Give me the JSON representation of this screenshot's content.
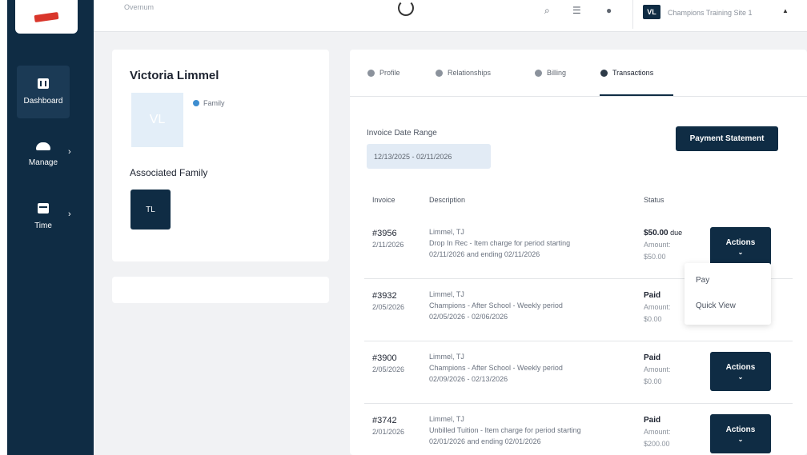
{
  "topbar": {
    "search_text": "Overnum",
    "site_avatar": "VL",
    "site_name": "Champions Training Site 1"
  },
  "sidebar": {
    "items": [
      {
        "label": "Dashboard",
        "icon": "dashboard-icon",
        "active": true
      },
      {
        "label": "Manage",
        "icon": "people-icon"
      },
      {
        "label": "Time",
        "icon": "calendar-icon"
      }
    ]
  },
  "profile": {
    "name": "Victoria Limmel",
    "avatar": "VL",
    "role": "Family",
    "assoc_label": "Associated Family",
    "assoc_avatar": "TL"
  },
  "tabs": [
    {
      "label": "Profile"
    },
    {
      "label": "Relationships"
    },
    {
      "label": "Billing"
    },
    {
      "label": "Transactions",
      "active": true
    }
  ],
  "filters": {
    "range_label": "Invoice Date Range",
    "range_value": "12/13/2025 - 02/11/2026",
    "statement_button": "Payment Statement"
  },
  "table": {
    "headers": [
      "Invoice",
      "Description",
      "Status"
    ],
    "rows": [
      {
        "number": "#3956",
        "date": "2/11/2026",
        "name": "Limmel, TJ",
        "line1": "Drop In Rec - Item charge for period starting",
        "line2": "02/11/2026 and ending 02/11/2026",
        "status": "$50.00",
        "status_suffix": "due",
        "amount_label": "Amount:",
        "amount": "$50.00",
        "action": "Actions"
      },
      {
        "number": "#3932",
        "date": "2/05/2026",
        "name": "Limmel, TJ",
        "line1": "Champions - After School - Weekly period",
        "line2": "02/05/2026 - 02/06/2026",
        "status": "Paid",
        "status_suffix": "",
        "amount_label": "Amount:",
        "amount": "$0.00",
        "action": ""
      },
      {
        "number": "#3900",
        "date": "2/05/2026",
        "name": "Limmel, TJ",
        "line1": "Champions - After School - Weekly period",
        "line2": "02/09/2026 - 02/13/2026",
        "status": "Paid",
        "status_suffix": "",
        "amount_label": "Amount:",
        "amount": "$0.00",
        "action": "Actions"
      },
      {
        "number": "#3742",
        "date": "2/01/2026",
        "name": "Limmel, TJ",
        "line1": "Unbilled Tuition - Item charge for period starting",
        "line2": "02/01/2026 and ending 02/01/2026",
        "status": "Paid",
        "status_suffix": "",
        "amount_label": "Amount:",
        "amount": "$200.00",
        "action": "Actions"
      }
    ]
  },
  "dropdown": {
    "items": [
      "Pay",
      "Quick View"
    ]
  },
  "colors": {
    "navy": "#0f2c44",
    "accent_blue": "#3e8ed0"
  }
}
